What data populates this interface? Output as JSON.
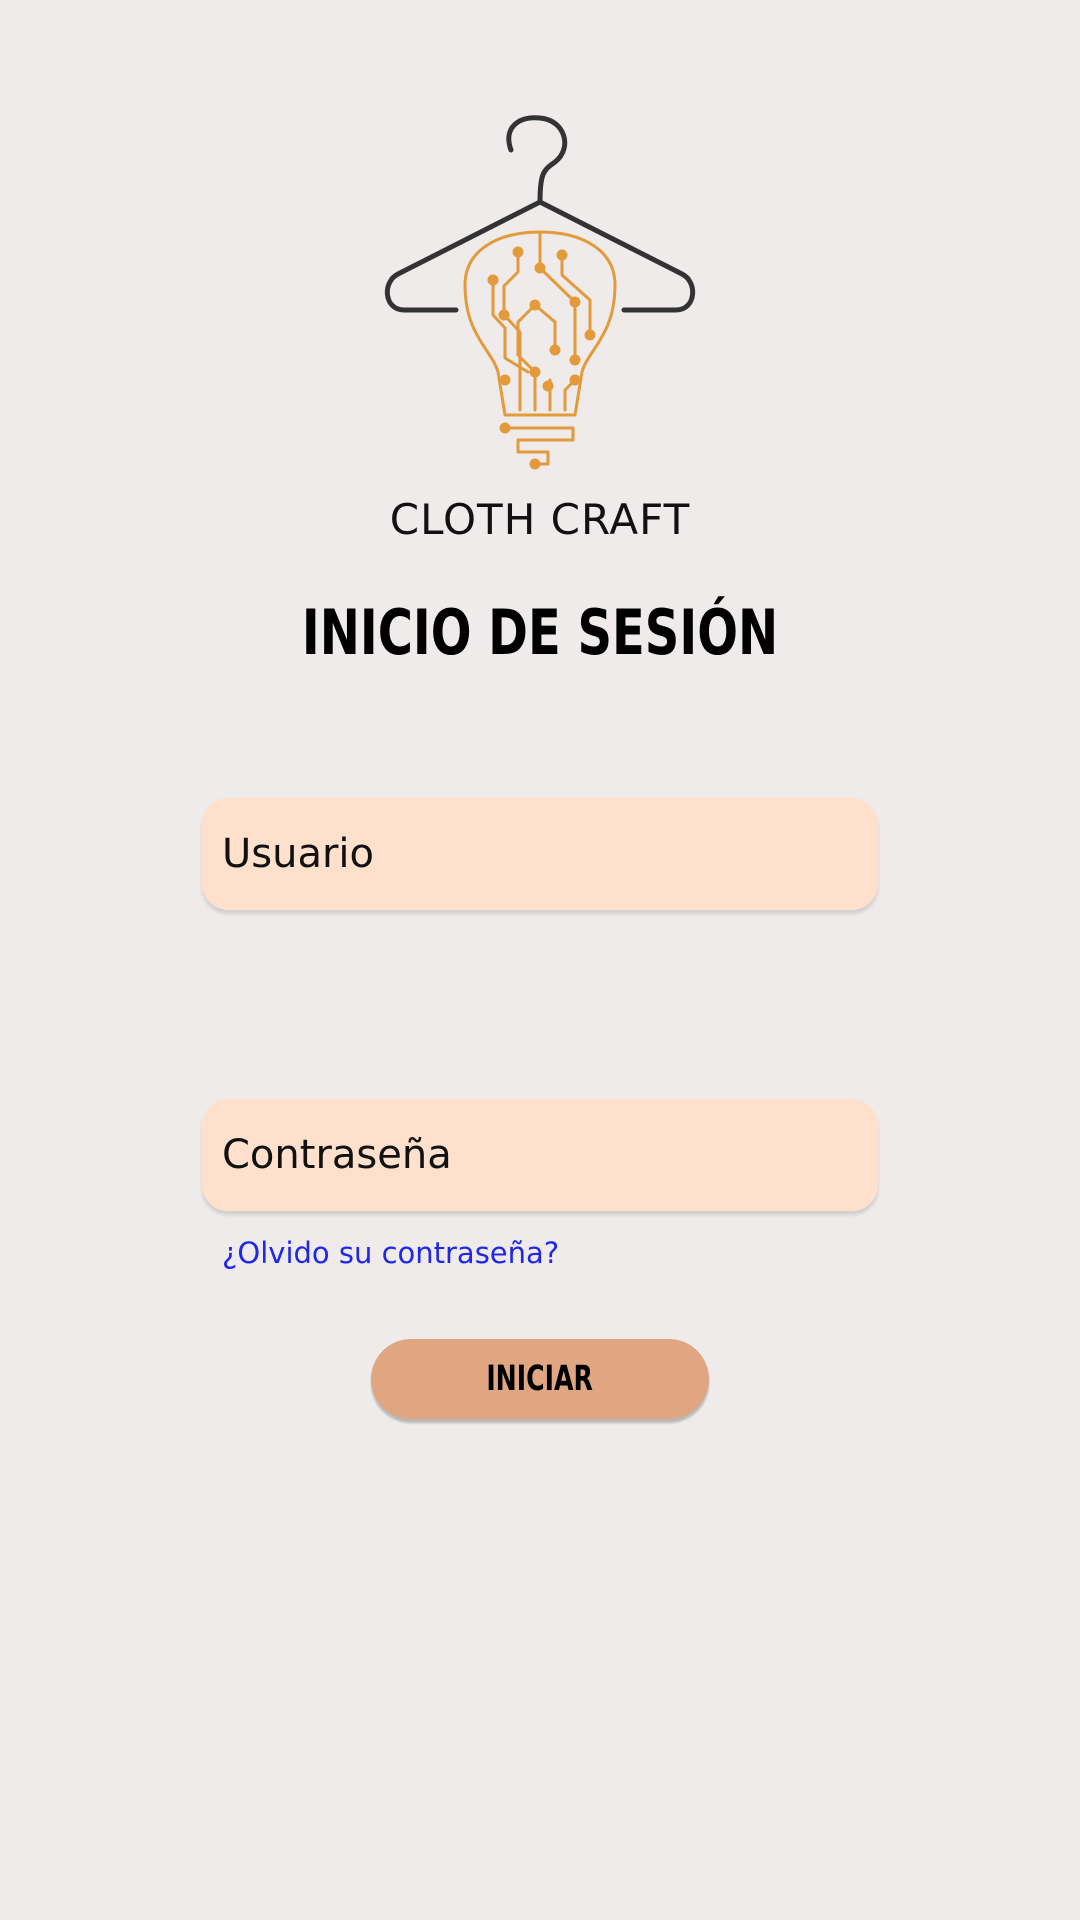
{
  "brand": {
    "logo_icon": "hanger-lightbulb-circuit-icon",
    "name": "CLOTH CRAFT",
    "colors": {
      "hanger": "#333333",
      "bulb": "#e39a3b"
    }
  },
  "page": {
    "title": "INICIO DE SESIÓN",
    "background": "#efebeb"
  },
  "form": {
    "username": {
      "placeholder": "Usuario",
      "value": ""
    },
    "password": {
      "placeholder": "Contraseña",
      "value": ""
    },
    "field_color": "#fee0cc",
    "forgot_link": "¿Olvido su contraseña?",
    "forgot_color": "#1e28e6",
    "submit_label": "INICIAR",
    "submit_color": "#e0a681"
  }
}
